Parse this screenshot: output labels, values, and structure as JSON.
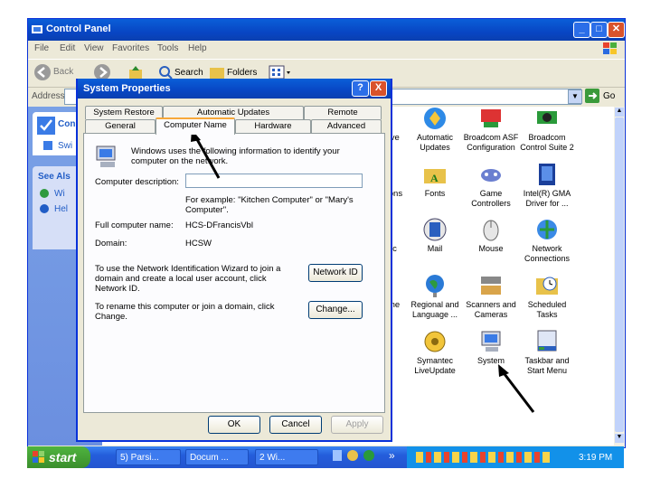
{
  "window": {
    "title": "Control Panel",
    "menu": [
      "File",
      "Edit",
      "View",
      "Favorites",
      "Tools",
      "Help"
    ],
    "toolbar": {
      "back": "Back",
      "search": "Search",
      "folders": "Folders"
    },
    "address_label": "Address",
    "go_label": "Go"
  },
  "left_pane": {
    "control_panel": "Con",
    "switch": "Swi",
    "see_also": "See Als",
    "item1": "Wi",
    "item2": "Hel"
  },
  "icons": [
    {
      "label": "tive"
    },
    {
      "label": "Automatic Updates"
    },
    {
      "label": "Broadcom ASF Configuration"
    },
    {
      "label": "Broadcom Control Suite 2"
    },
    {
      "label": "tions"
    },
    {
      "label": "Fonts"
    },
    {
      "label": "Game Controllers"
    },
    {
      "label": "Intel(R) GMA Driver for ..."
    },
    {
      "label": "rc"
    },
    {
      "label": "Mail"
    },
    {
      "label": "Mouse"
    },
    {
      "label": "Network Connections"
    },
    {
      "label": "me"
    },
    {
      "label": "Regional and Language ..."
    },
    {
      "label": "Scanners and Cameras"
    },
    {
      "label": "Scheduled Tasks"
    },
    {
      "label": "h"
    },
    {
      "label": "Symantec LiveUpdate"
    },
    {
      "label": "System"
    },
    {
      "label": "Taskbar and Start Menu"
    }
  ],
  "dialog": {
    "title": "System Properties",
    "tabs_back": [
      "System Restore",
      "Automatic Updates",
      "Remote"
    ],
    "tabs_front": [
      "General",
      "Computer Name",
      "Hardware",
      "Advanced"
    ],
    "intro": "Windows uses the following information to identify your computer on the network.",
    "desc_label": "Computer description:",
    "desc_value": "",
    "example": "For example: \"Kitchen Computer\" or \"Mary's Computer\".",
    "full_name_label": "Full computer name:",
    "full_name_value": "HCS-DFrancisVbl",
    "domain_label": "Domain:",
    "domain_value": "HCSW",
    "netid_text": "To use the Network Identification Wizard to join a domain and create a local user account, click Network ID.",
    "netid_button": "Network ID",
    "rename_text": "To rename this computer or join a domain, click Change.",
    "change_button": "Change...",
    "ok": "OK",
    "cancel": "Cancel",
    "apply": "Apply",
    "help_btn": "?",
    "close_btn": "X"
  },
  "taskbar": {
    "start": "start",
    "tasks": [
      "5) Parsi...",
      "Docum ...",
      "2 Wi..."
    ],
    "clock": "3:19 PM",
    "chevron": "»"
  },
  "colors": {
    "title_blue": "#0846c4",
    "taskbar_blue": "#245ddb",
    "start_green": "#3a8e2c",
    "arrow": "#000000"
  }
}
